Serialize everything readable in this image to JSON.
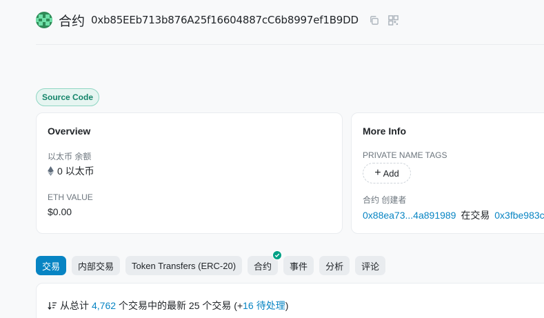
{
  "header": {
    "title": "合约",
    "address": "0xb85EEb713b876A25f16604887cC6b8997ef1B9DD",
    "icons": [
      "copy-icon",
      "qr-code-icon"
    ]
  },
  "badge": {
    "label": "Source Code"
  },
  "overview": {
    "title": "Overview",
    "eth_balance_label": "以太币 余额",
    "eth_balance_value": "0 以太币",
    "eth_value_label": "ETH VALUE",
    "eth_value_value": "$0.00"
  },
  "more_info": {
    "title": "More Info",
    "private_tags_label": "PRIVATE NAME TAGS",
    "add_label": "Add",
    "creator_label": "合约 创建者",
    "creator_address": "0x88ea73...4a891989",
    "creator_in_tx": "在交易",
    "creator_tx": "0x3fbe983c"
  },
  "tabs": [
    {
      "label": "交易",
      "active": true
    },
    {
      "label": "内部交易"
    },
    {
      "label": "Token Transfers (ERC-20)"
    },
    {
      "label": "合约",
      "verified": true
    },
    {
      "label": "事件"
    },
    {
      "label": "分析"
    },
    {
      "label": "评论"
    }
  ],
  "transactions": {
    "prefix": "从总计",
    "total": "4,762",
    "middle": "个交易中的最新 25 个交易 (+",
    "pending_count": "16",
    "pending_label": "待处理",
    "suffix": ")"
  },
  "colors": {
    "accent": "#0784c3",
    "badge_text": "#15856a",
    "verified": "#00a186"
  }
}
